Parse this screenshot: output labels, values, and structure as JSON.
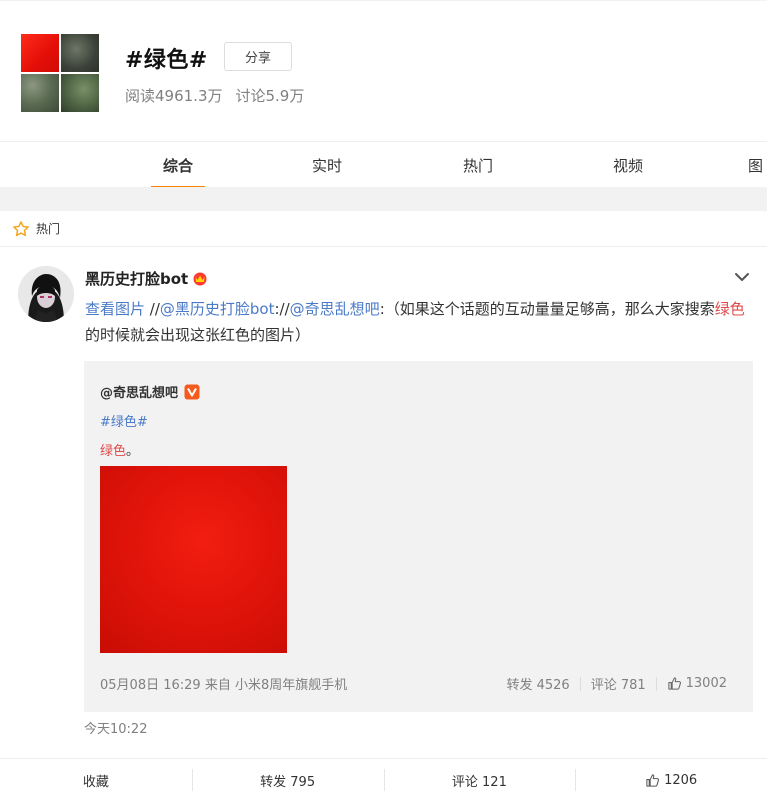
{
  "topic": {
    "title": "#绿色#",
    "share_label": "分享",
    "reads": "阅读4961.3万",
    "discussions": "讨论5.9万"
  },
  "tabs": [
    {
      "label": "综合",
      "active": true
    },
    {
      "label": "实时",
      "active": false
    },
    {
      "label": "热门",
      "active": false
    },
    {
      "label": "视频",
      "active": false
    },
    {
      "label": "图",
      "active": false
    }
  ],
  "section": {
    "label": "热门",
    "icon": "star-icon"
  },
  "post": {
    "username": "黑历史打脸bot",
    "text": {
      "view_pic": "查看图片",
      "sep1": " //",
      "mention1": "@黑历史打脸bot",
      "sep2": "://",
      "mention2": "@奇思乱想吧",
      "body1": ":（如果这个话题的互动量量足够高，那么大家搜索",
      "highlight": "绿色",
      "body2": "的时候就会出现这张红色的图片）"
    },
    "time": "今天10:22"
  },
  "repost": {
    "user": "@奇思乱想吧",
    "tag": "#绿色#",
    "text_highlight": "绿色",
    "text_end": "。",
    "meta": "05月08日 16:29 来自 小米8周年旗舰手机",
    "forward": "转发 4526",
    "comment": "评论 781",
    "likes": "13002"
  },
  "actions": {
    "favorite": "收藏",
    "forward": "转发 795",
    "comment": "评论 121",
    "likes": "1206"
  },
  "colors": {
    "accent": "#ff8200",
    "link": "#4a7ac7",
    "highlight": "#e04a4a",
    "red_image": "#e2140a"
  }
}
